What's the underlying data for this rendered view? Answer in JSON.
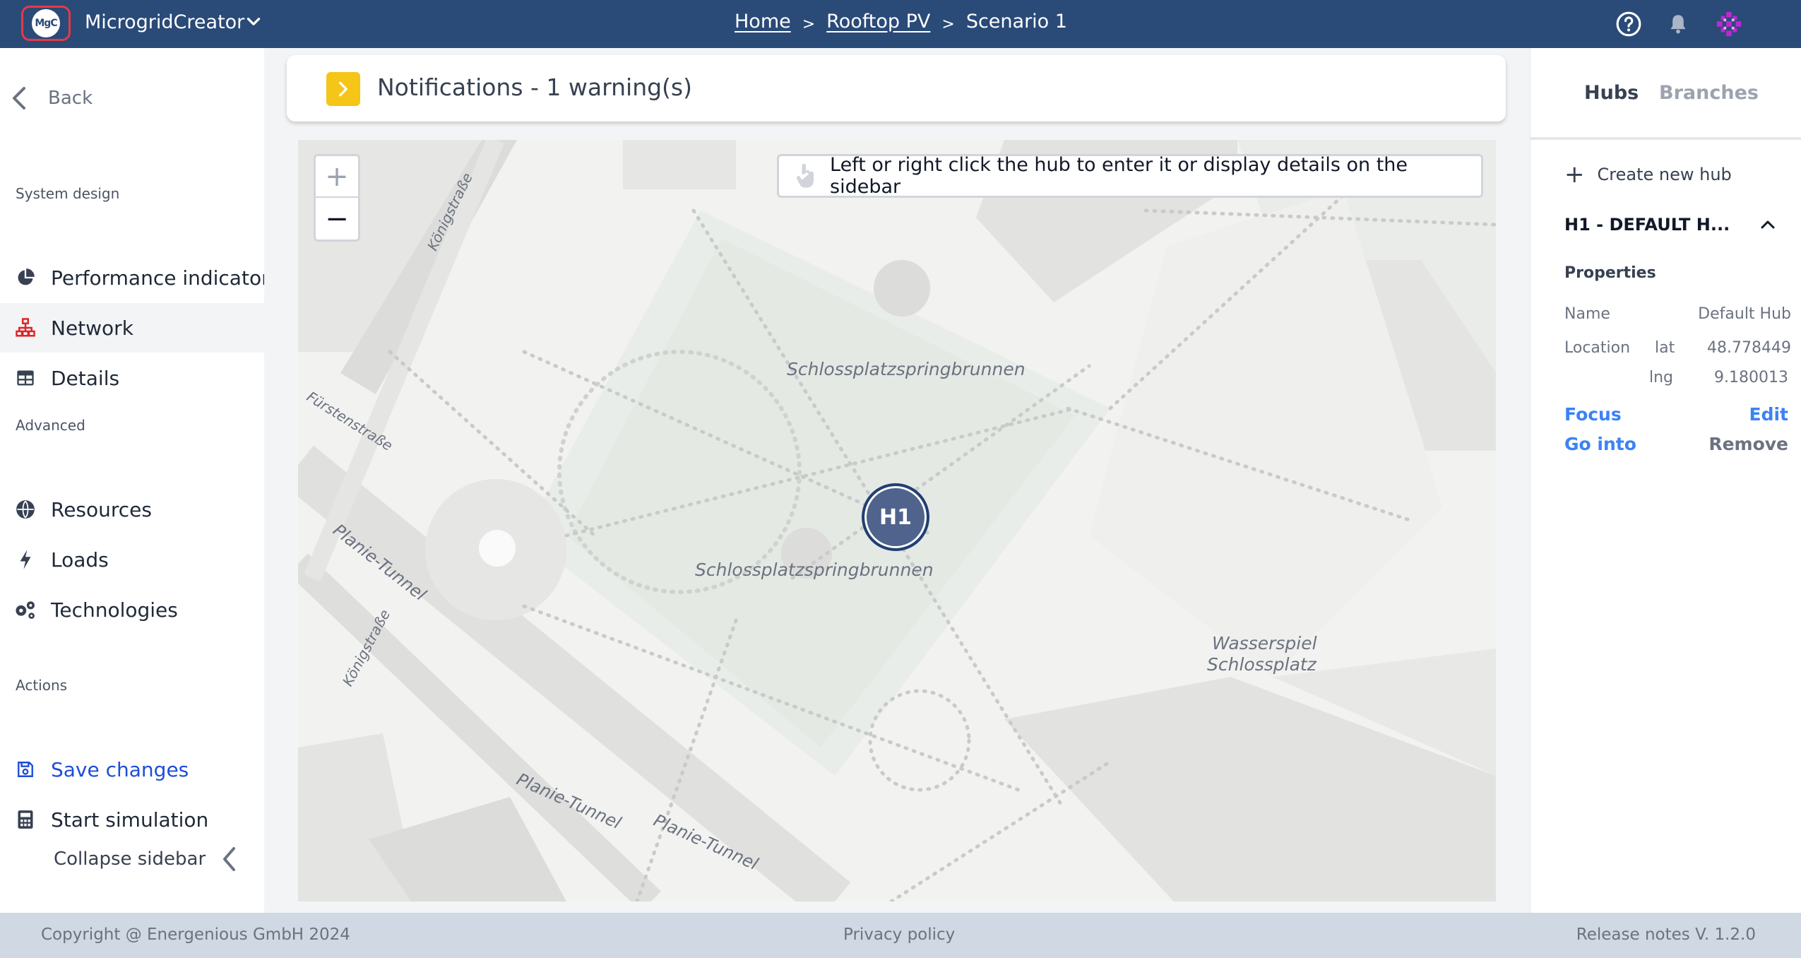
{
  "header": {
    "logo_text": "MgC",
    "app_name": "MicrogridCreator",
    "breadcrumbs": [
      "Home",
      "Rooftop PV",
      "Scenario 1"
    ],
    "breadcrumb_separator": ">",
    "icons": [
      "help-icon",
      "bell-icon",
      "user-avatar-icon"
    ],
    "background_color": "#2a4a78"
  },
  "sidebar": {
    "back_label": "Back",
    "sections": {
      "system_design": "System design",
      "advanced": "Advanced",
      "actions": "Actions"
    },
    "items": {
      "performance_indicators": "Performance indicators",
      "network": "Network",
      "details": "Details",
      "resources": "Resources",
      "loads": "Loads",
      "technologies": "Technologies",
      "save_changes": "Save changes",
      "start_simulation": "Start simulation"
    },
    "active_item": "Network",
    "collapse_label": "Collapse sidebar"
  },
  "notifications": {
    "title": "Notifications - 1 warning(s)",
    "badge_color": "#f5c518"
  },
  "map": {
    "zoom_in": "+",
    "zoom_out": "−",
    "hint": "Left or right click the hub to enter it or display details on the sidebar",
    "labels": {
      "konigstrasse_top": "Königstraße",
      "fuerstenstrasse": "Fürstenstraße",
      "planie_tunnel_left": "Planie-Tunnel",
      "konigstrasse_bottom": "Königstraße",
      "schlossplatzspringbrunnen_top": "Schlossplatzspringbrunnen",
      "schlossplatzspringbrunnen_bottom": "Schlossplatzspringbrunnen",
      "wasserspiel_1": "Wasserspiel",
      "wasserspiel_2": "Schlossplatz",
      "planie_tunnel_b1": "Planie-Tunnel",
      "planie_tunnel_b2": "Planie-Tunnel"
    },
    "hub_marker": "H1"
  },
  "right_panel": {
    "tabs": [
      "Hubs",
      "Branches"
    ],
    "active_tab": "Hubs",
    "create_hub": "Create new hub",
    "hub_title": "H1 - DEFAULT H...",
    "properties_title": "Properties",
    "name_label": "Name",
    "name_value": "Default Hub",
    "location_label": "Location",
    "lat_label": "lat",
    "lat_value": "48.778449",
    "lng_label": "lng",
    "lng_value": "9.180013",
    "actions": {
      "focus": "Focus",
      "edit": "Edit",
      "go_into": "Go into",
      "remove": "Remove"
    }
  },
  "footer": {
    "copyright": "Copyright @ Energenious GmbH 2024",
    "privacy": "Privacy policy",
    "release_notes": "Release notes V. 1.2.0"
  }
}
